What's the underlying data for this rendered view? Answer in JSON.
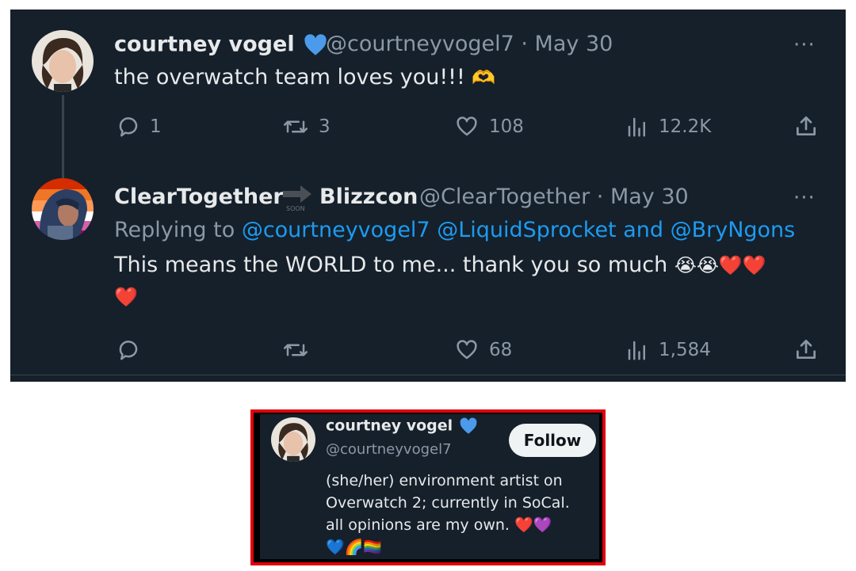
{
  "tweet1": {
    "name": "courtney vogel",
    "handle": "@courtneyvogel7",
    "date": "· May 30",
    "text": "the overwatch team loves you!!!",
    "emoji": "🫶",
    "more": "···",
    "replies": "1",
    "retweets": "3",
    "likes": "108",
    "views": "12.2K"
  },
  "tweet2": {
    "name": "ClearTogether",
    "name_suffix": "Blizzcon",
    "badge_label": "SOON",
    "handle": "@ClearTogether",
    "date": "· May 30",
    "replying_prefix": "Replying to",
    "reply_mentions": "@courtneyvogel7 @LiquidSprocket and @BryNgons",
    "text": "This means the WORLD to me... thank you so much",
    "emoji_line1": "😭😭❤️❤️",
    "emoji_line2": "❤️",
    "more": "···",
    "replies": "",
    "retweets": "",
    "likes": "68",
    "views": "1,584"
  },
  "profile_card": {
    "name": "courtney vogel",
    "handle": "@courtneyvogel7",
    "follow_label": "Follow",
    "bio_line1": "(she/her) environment artist on",
    "bio_line2": "Overwatch 2; currently in SoCal.",
    "bio_line3": "all opinions are my own.",
    "bio_emoji1": "❤️💜",
    "bio_emoji2": "💙🌈🏳️‍🌈"
  },
  "colors": {
    "background": "#15202b",
    "text": "#e7e9ea",
    "muted": "#8b98a5",
    "link": "#1d9bf0",
    "verified": "#4b9bea",
    "card_border": "#e0000f"
  },
  "icons": [
    "reply-icon",
    "retweet-icon",
    "like-icon",
    "views-icon",
    "share-icon",
    "verified-icon",
    "more-icon"
  ]
}
